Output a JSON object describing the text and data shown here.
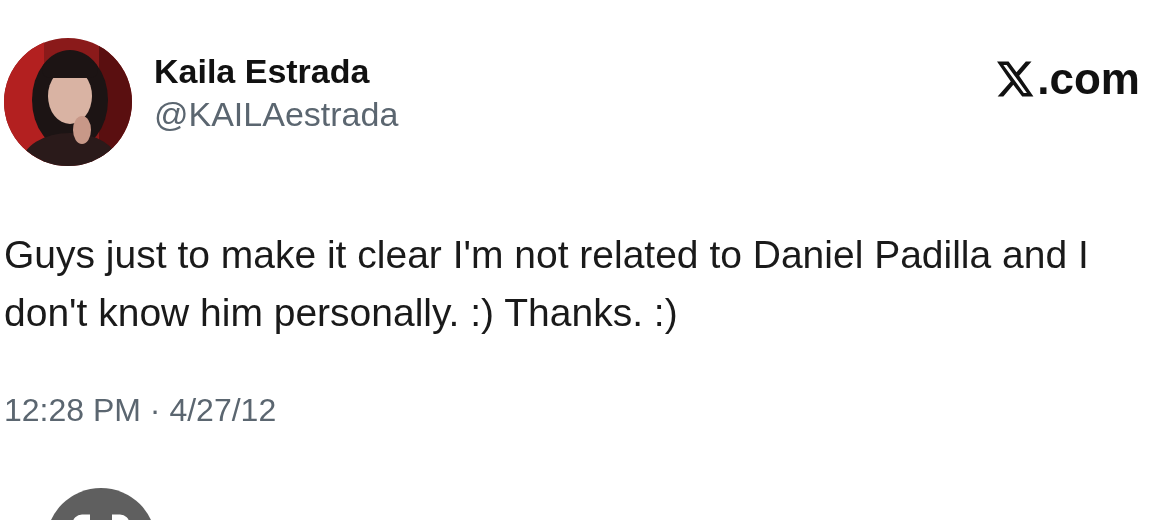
{
  "author": {
    "name": "Kaila Estrada",
    "handle": "@KAILAestrada"
  },
  "site": {
    "label": ".com"
  },
  "tweet": {
    "text": "Guys just to make it clear I'm not related to Daniel Padilla and I don't know him personally. :) Thanks. :)",
    "timestamp": "12:28 PM · 4/27/12"
  }
}
